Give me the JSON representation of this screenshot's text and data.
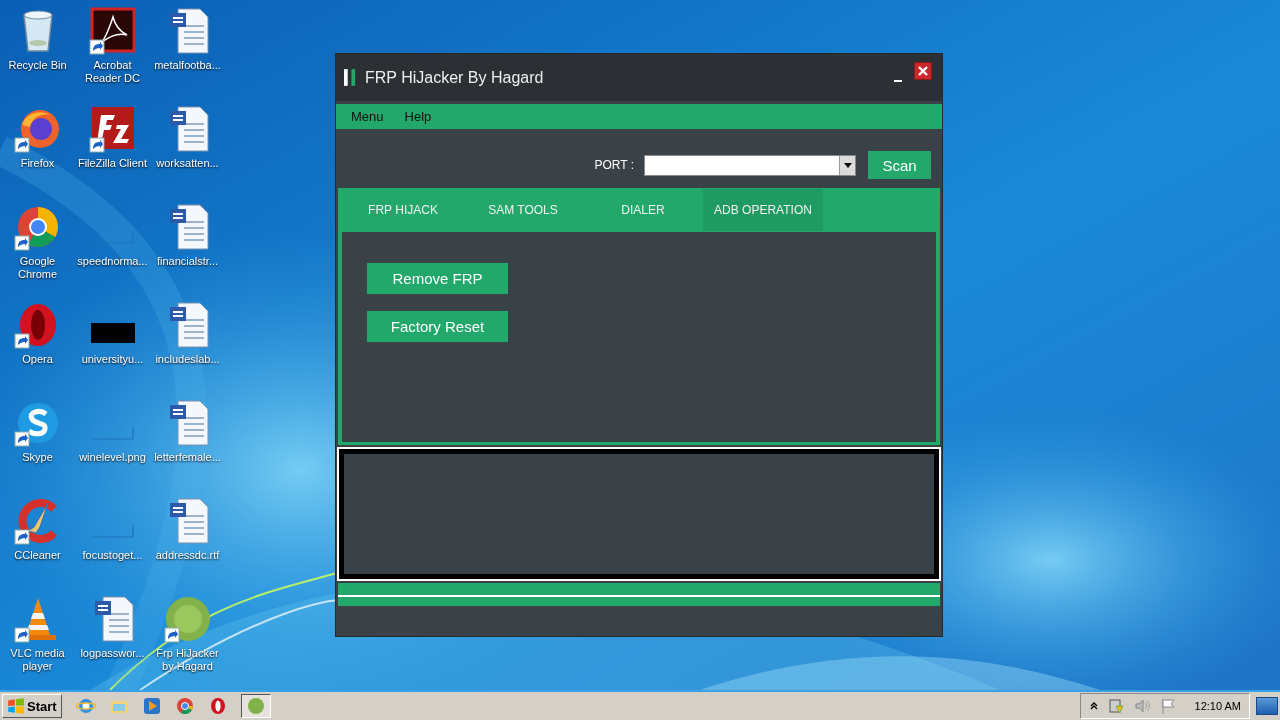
{
  "desktop_icons": [
    {
      "label": "Recycle Bin",
      "kind": "recycle",
      "shortcut": false
    },
    {
      "label": "Firefox",
      "kind": "firefox",
      "shortcut": true
    },
    {
      "label": "Google Chrome",
      "kind": "chrome",
      "shortcut": true
    },
    {
      "label": "Opera",
      "kind": "opera",
      "shortcut": true
    },
    {
      "label": "Skype",
      "kind": "skype",
      "shortcut": true
    },
    {
      "label": "CCleaner",
      "kind": "ccleaner",
      "shortcut": true
    },
    {
      "label": "VLC media player",
      "kind": "vlc",
      "shortcut": true
    },
    {
      "label": "Acrobat Reader DC",
      "kind": "acrobat",
      "shortcut": true
    },
    {
      "label": "FileZilla Client",
      "kind": "filezilla",
      "shortcut": true
    },
    {
      "label": "speednorma...",
      "kind": "thumb",
      "shortcut": false
    },
    {
      "label": "universityu...",
      "kind": "black",
      "shortcut": false
    },
    {
      "label": "winelevel.png",
      "kind": "thumb",
      "shortcut": false
    },
    {
      "label": "focustoget...",
      "kind": "thumb",
      "shortcut": false
    },
    {
      "label": "logpasswor...",
      "kind": "word",
      "shortcut": false
    },
    {
      "label": "metalfootba...",
      "kind": "word",
      "shortcut": false
    },
    {
      "label": "worksatten...",
      "kind": "word",
      "shortcut": false
    },
    {
      "label": "financialstr...",
      "kind": "word",
      "shortcut": false
    },
    {
      "label": "includeslab...",
      "kind": "word",
      "shortcut": false
    },
    {
      "label": "letterfemale...",
      "kind": "word",
      "shortcut": false
    },
    {
      "label": "addressdc.rtf",
      "kind": "word",
      "shortcut": false
    },
    {
      "label": "Frp HiJacker by Hagard",
      "kind": "frp",
      "shortcut": true
    }
  ],
  "window": {
    "title": "FRP HiJacker By Hagard",
    "menu": [
      "Menu",
      "Help"
    ],
    "port_label": "PORT :",
    "scan_button": "Scan",
    "tabs": [
      {
        "label": "FRP HIJACK",
        "selected": false
      },
      {
        "label": "SAM TOOLS",
        "selected": false
      },
      {
        "label": "DIALER",
        "selected": false
      },
      {
        "label": "ADB OPERATION",
        "selected": true
      }
    ],
    "actions": [
      "Remove FRP",
      "Factory Reset"
    ]
  },
  "taskbar": {
    "start": "Start",
    "tasks": [
      {
        "kind": "ie",
        "active": false
      },
      {
        "kind": "folder",
        "active": false
      },
      {
        "kind": "media",
        "active": false
      },
      {
        "kind": "chrome",
        "active": false
      },
      {
        "kind": "opera",
        "active": false
      },
      {
        "kind": "frp",
        "active": true
      }
    ],
    "clock": "12:10 AM"
  }
}
